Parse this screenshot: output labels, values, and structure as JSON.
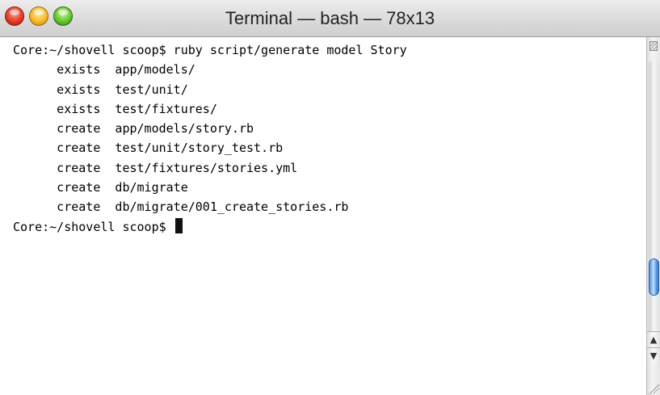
{
  "window": {
    "title": "Terminal — bash — 78x13"
  },
  "terminal": {
    "lines": [
      "Core:~/shovell scoop$ ruby script/generate model Story",
      "      exists  app/models/",
      "      exists  test/unit/",
      "      exists  test/fixtures/",
      "      create  app/models/story.rb",
      "      create  test/unit/story_test.rb",
      "      create  test/fixtures/stories.yml",
      "      create  db/migrate",
      "      create  db/migrate/001_create_stories.rb"
    ],
    "prompt": "Core:~/shovell scoop$ "
  },
  "scrollbar": {
    "up_arrow": "▲",
    "down_arrow": "▼"
  }
}
